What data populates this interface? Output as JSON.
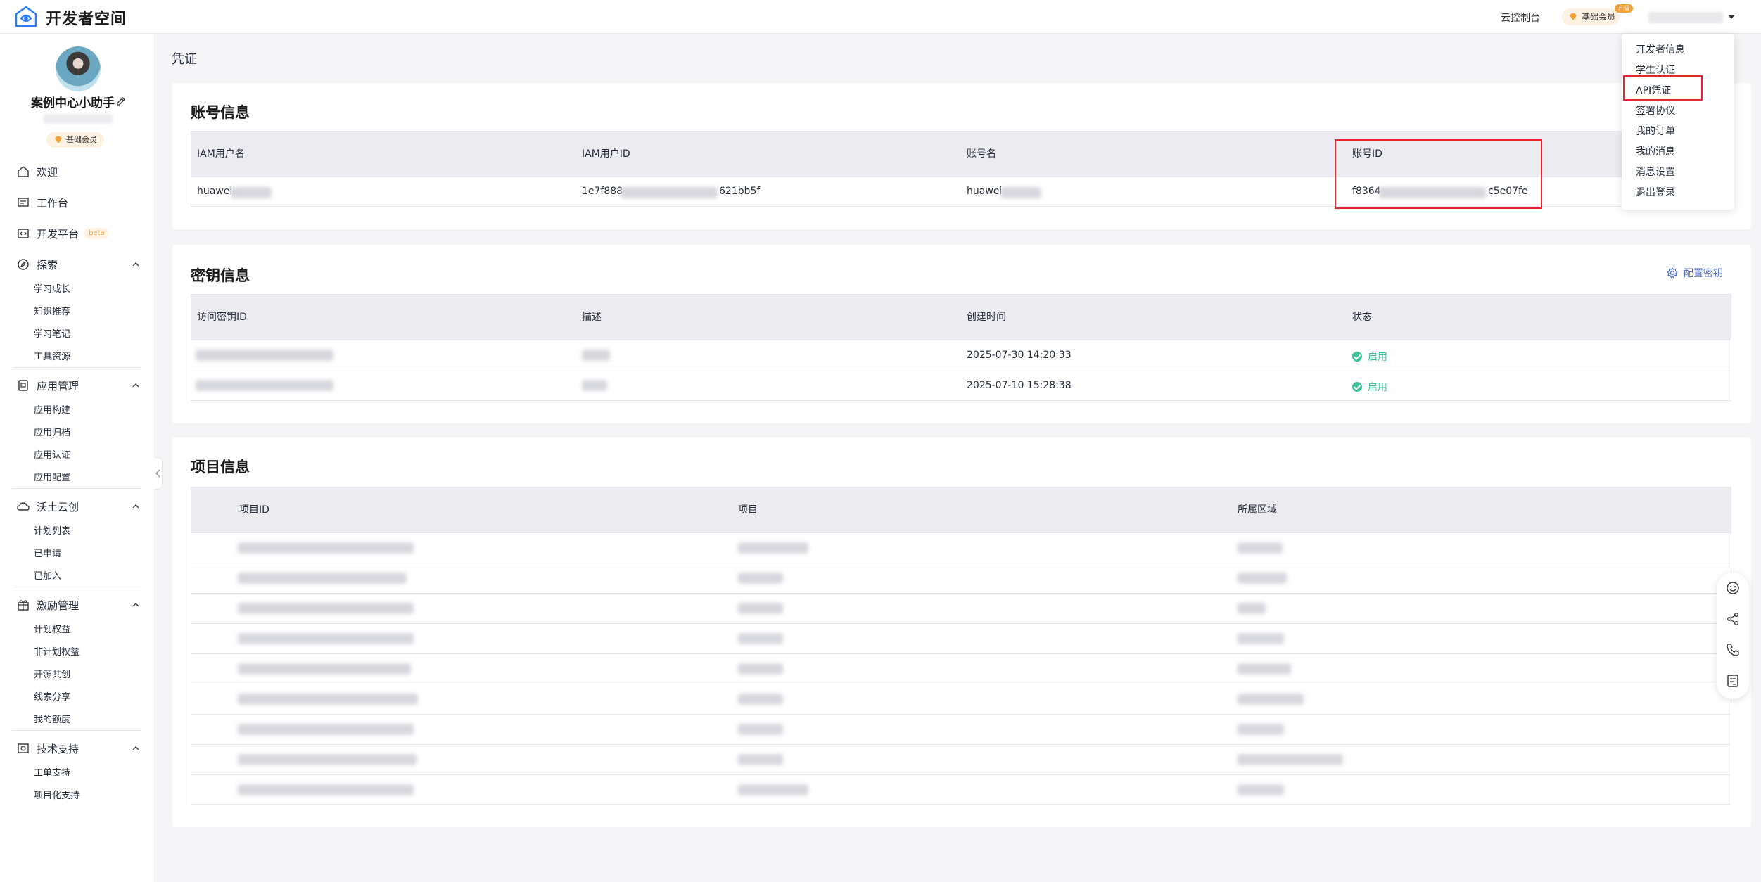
{
  "app": {
    "brand": "开发者空间",
    "nav_console": "云控制台",
    "member_label": "基础会员",
    "upgrade_badge": "升级"
  },
  "profile": {
    "name": "案例中心小助手",
    "member_label": "基础会员"
  },
  "sidebar": {
    "welcome": "欢迎",
    "workbench": "工作台",
    "dev_platform": "开发平台",
    "beta": "beta",
    "explore": "探索",
    "explore_items": [
      "学习成长",
      "知识推荐",
      "学习笔记",
      "工具资源"
    ],
    "app_mgmt": "应用管理",
    "app_items": [
      "应用构建",
      "应用归档",
      "应用认证",
      "应用配置"
    ],
    "wotu": "沃土云创",
    "wotu_items": [
      "计划列表",
      "已申请",
      "已加入"
    ],
    "incentive": "激励管理",
    "incentive_items": [
      "计划权益",
      "非计划权益",
      "开源共创",
      "线索分享",
      "我的额度"
    ],
    "tech_support": "技术支持",
    "tech_items": [
      "工单支持",
      "项目化支持"
    ]
  },
  "main": {
    "page_title": "凭证",
    "account": {
      "title": "账号信息",
      "headers": [
        "IAM用户名",
        "IAM用户ID",
        "账号名",
        "账号ID"
      ],
      "row": [
        "huawei",
        "1e7f888",
        "621bb5f",
        "huawei",
        "f8364",
        "c5e07fe"
      ]
    },
    "keys": {
      "title": "密钥信息",
      "config_label": "配置密钥",
      "headers": [
        "访问密钥ID",
        "描述",
        "创建时间",
        "状态"
      ],
      "rows": [
        {
          "created": "2025-07-30 14:20:33",
          "status": "启用"
        },
        {
          "created": "2025-07-10 15:28:38",
          "status": "启用"
        }
      ]
    },
    "projects": {
      "title": "项目信息",
      "headers": [
        "项目ID",
        "项目",
        "所属区域"
      ]
    }
  },
  "dropdown": {
    "items": [
      "开发者信息",
      "学生认证",
      "API凭证",
      "签署协议",
      "我的订单",
      "我的消息",
      "消息设置",
      "退出登录"
    ]
  },
  "float_tools": [
    "smile-icon",
    "share-icon",
    "phone-icon",
    "feedback-icon"
  ],
  "colors": {
    "highlight": "#e8242c",
    "status_green": "#3ac295",
    "link_blue": "#526ecc",
    "member_orange": "#f29f34"
  }
}
